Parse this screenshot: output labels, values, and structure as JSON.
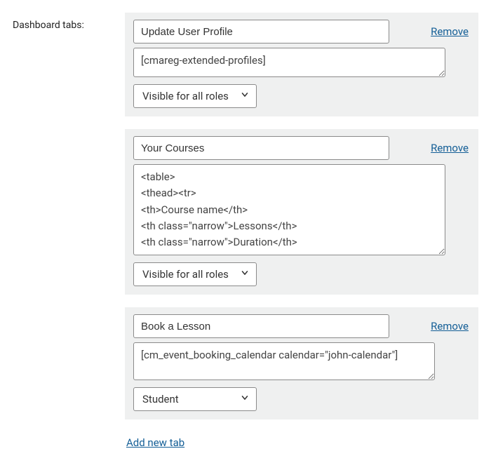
{
  "label": "Dashboard tabs:",
  "remove_label": "Remove",
  "add_label": "Add new tab",
  "tabs": [
    {
      "title": "Update User Profile",
      "content": "[cmareg-extended-profiles]",
      "role": "Visible for all roles"
    },
    {
      "title": "Your Courses",
      "content": "<table>\n<thead><tr>\n<th>Course name</th>\n<th class=\"narrow\">Lessons</th>\n<th class=\"narrow\">Duration</th>",
      "role": "Visible for all roles"
    },
    {
      "title": "Book a Lesson",
      "content": "[cm_event_booking_calendar calendar=\"john-calendar\"]",
      "role": "Student"
    }
  ]
}
